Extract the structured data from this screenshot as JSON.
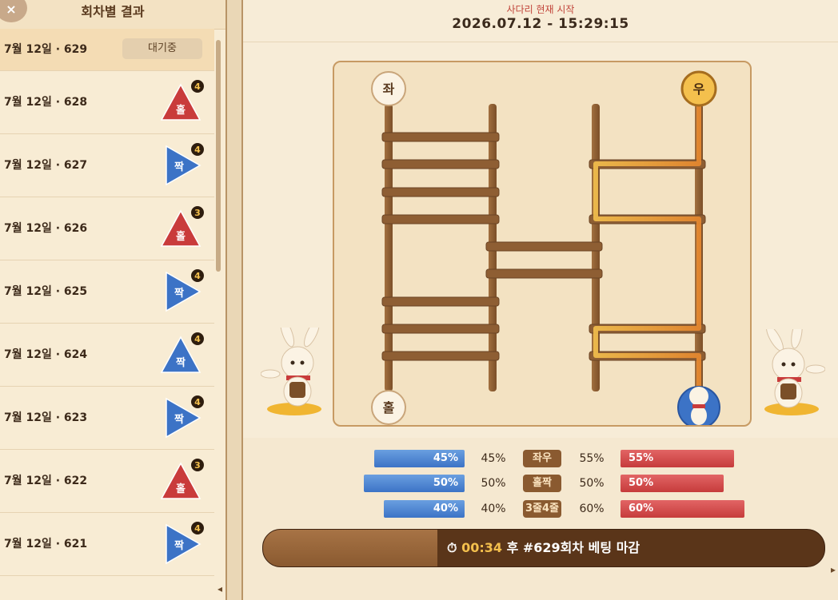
{
  "left": {
    "title": "회차별 결과",
    "close_icon": "×",
    "current": {
      "label": "7월 12일 · 629",
      "status": "대기중"
    },
    "rounds": [
      {
        "label": "7월 12일 · 628",
        "result": "홀",
        "lines": "4",
        "shape": "triangle",
        "color": "#c93b3b"
      },
      {
        "label": "7월 12일 · 627",
        "result": "짝",
        "lines": "4",
        "shape": "arrow",
        "color": "#3c73c6"
      },
      {
        "label": "7월 12일 · 626",
        "result": "홀",
        "lines": "3",
        "shape": "triangle",
        "color": "#c93b3b"
      },
      {
        "label": "7월 12일 · 625",
        "result": "짝",
        "lines": "4",
        "shape": "arrow",
        "color": "#3c73c6"
      },
      {
        "label": "7월 12일 · 624",
        "result": "짝",
        "lines": "4",
        "shape": "triangle",
        "color": "#3c73c6"
      },
      {
        "label": "7월 12일 · 623",
        "result": "짝",
        "lines": "4",
        "shape": "arrow",
        "color": "#3c73c6"
      },
      {
        "label": "7월 12일 · 622",
        "result": "홀",
        "lines": "3",
        "shape": "triangle",
        "color": "#c93b3b"
      },
      {
        "label": "7월 12일 · 621",
        "result": "짝",
        "lines": "4",
        "shape": "arrow",
        "color": "#3c73c6"
      }
    ]
  },
  "header": {
    "status": "사다리 현재 시작",
    "datetime": "2026.07.12 - 15:29:15"
  },
  "board": {
    "start_left": "좌",
    "start_right": "우",
    "end_left": "홀"
  },
  "stats": [
    {
      "blue_pct": 45,
      "blue_label": "45%",
      "left_text": "45%",
      "name": "좌우",
      "right_text": "55%",
      "red_pct": 55,
      "red_label": "55%"
    },
    {
      "blue_pct": 50,
      "blue_label": "50%",
      "left_text": "50%",
      "name": "홀짝",
      "right_text": "50%",
      "red_pct": 50,
      "red_label": "50%"
    },
    {
      "blue_pct": 40,
      "blue_label": "40%",
      "left_text": "40%",
      "name": "3줄4줄",
      "right_text": "60%",
      "red_pct": 60,
      "red_label": "60%"
    }
  ],
  "timer": {
    "icon": "⏱",
    "time": "00:34",
    "message": "후 #629회차 베팅 마감",
    "progress": 0.31
  },
  "colors": {
    "blue": "#3c73c6",
    "red": "#c93b3b",
    "wood": "#8a5a30",
    "highlight": "#f0a93a"
  }
}
